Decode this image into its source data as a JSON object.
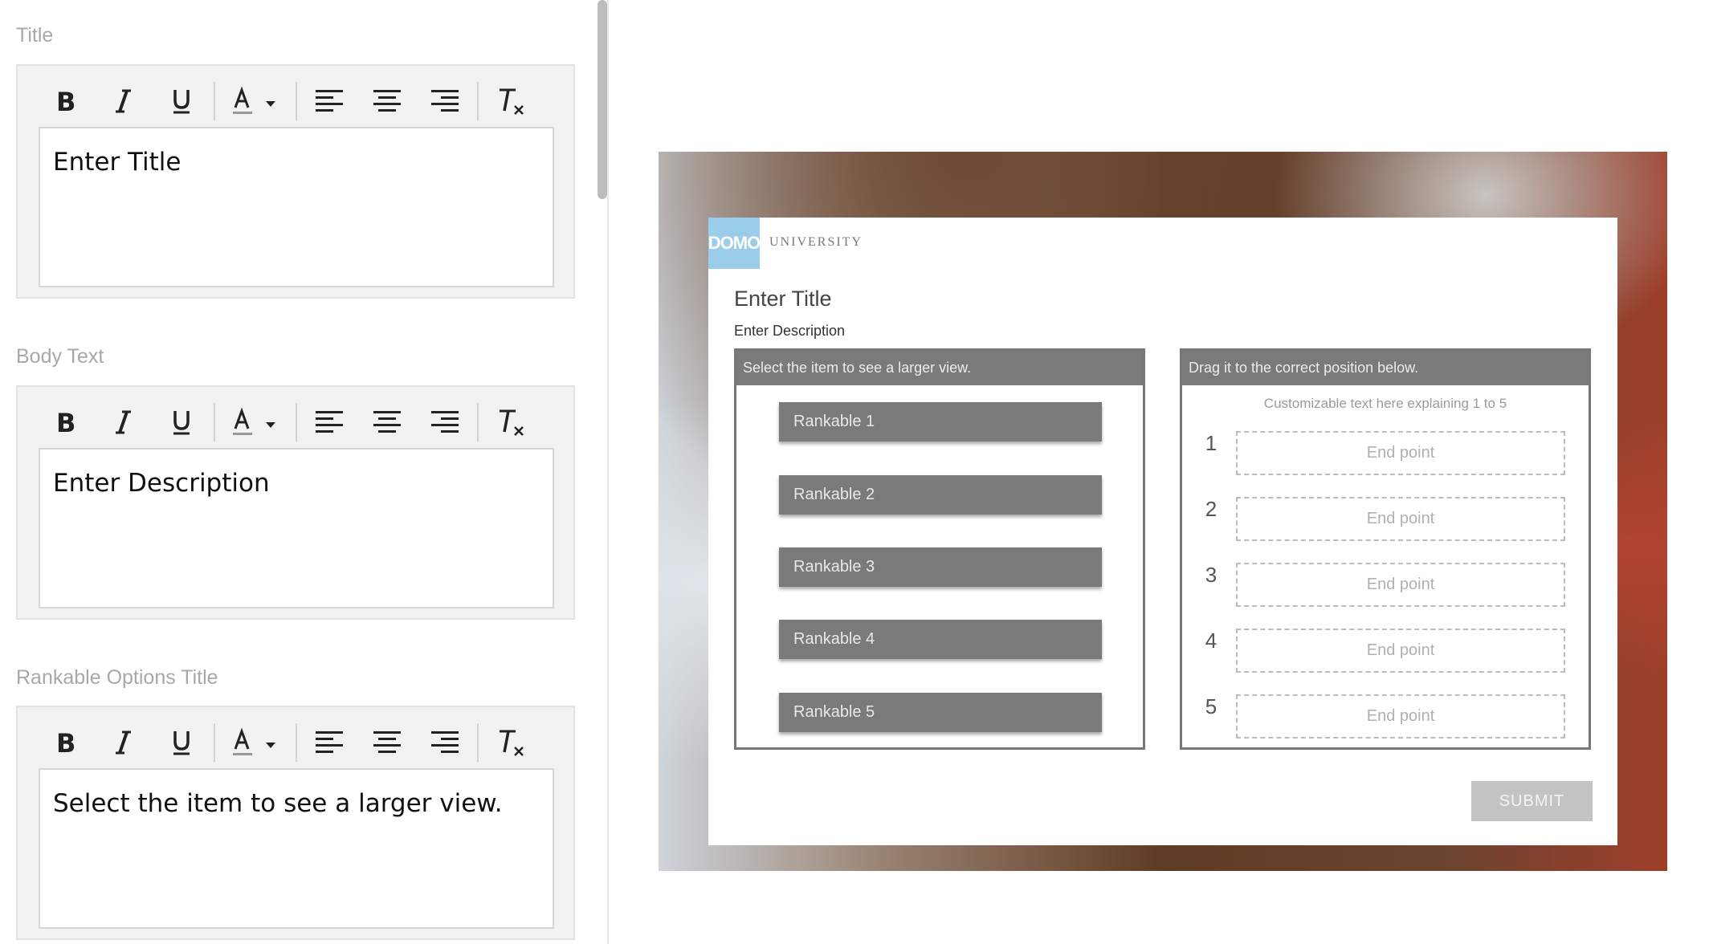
{
  "editor": {
    "sections": [
      {
        "label": "Title",
        "content": "Enter Title"
      },
      {
        "label": "Body Text",
        "content": "Enter Description"
      },
      {
        "label": "Rankable Options Title",
        "content": "Select the item to see a larger view."
      }
    ],
    "toolbar_icons": [
      "bold-icon",
      "italic-icon",
      "underline-icon",
      "text-color-icon",
      "align-left-icon",
      "align-center-icon",
      "align-right-icon",
      "clear-format-icon"
    ]
  },
  "preview": {
    "logo_text": "DOMO",
    "logo_subtitle": "UNIVERSITY",
    "title": "Enter Title",
    "description": "Enter Description",
    "left_header": "Select the item to see a larger view.",
    "right_header": "Drag it to the correct position below.",
    "right_hint": "Customizable text here explaining 1 to 5",
    "rankables": [
      "Rankable 1",
      "Rankable 2",
      "Rankable 3",
      "Rankable 4",
      "Rankable 5"
    ],
    "slots": [
      {
        "num": "1",
        "label": "End point"
      },
      {
        "num": "2",
        "label": "End point"
      },
      {
        "num": "3",
        "label": "End point"
      },
      {
        "num": "4",
        "label": "End point"
      },
      {
        "num": "5",
        "label": "End point"
      }
    ],
    "submit_label": "SUBMIT"
  },
  "colors": {
    "logo_blue": "#99cdea",
    "header_gray": "#7a7a7a",
    "submit_disabled": "#c3c3c3"
  }
}
